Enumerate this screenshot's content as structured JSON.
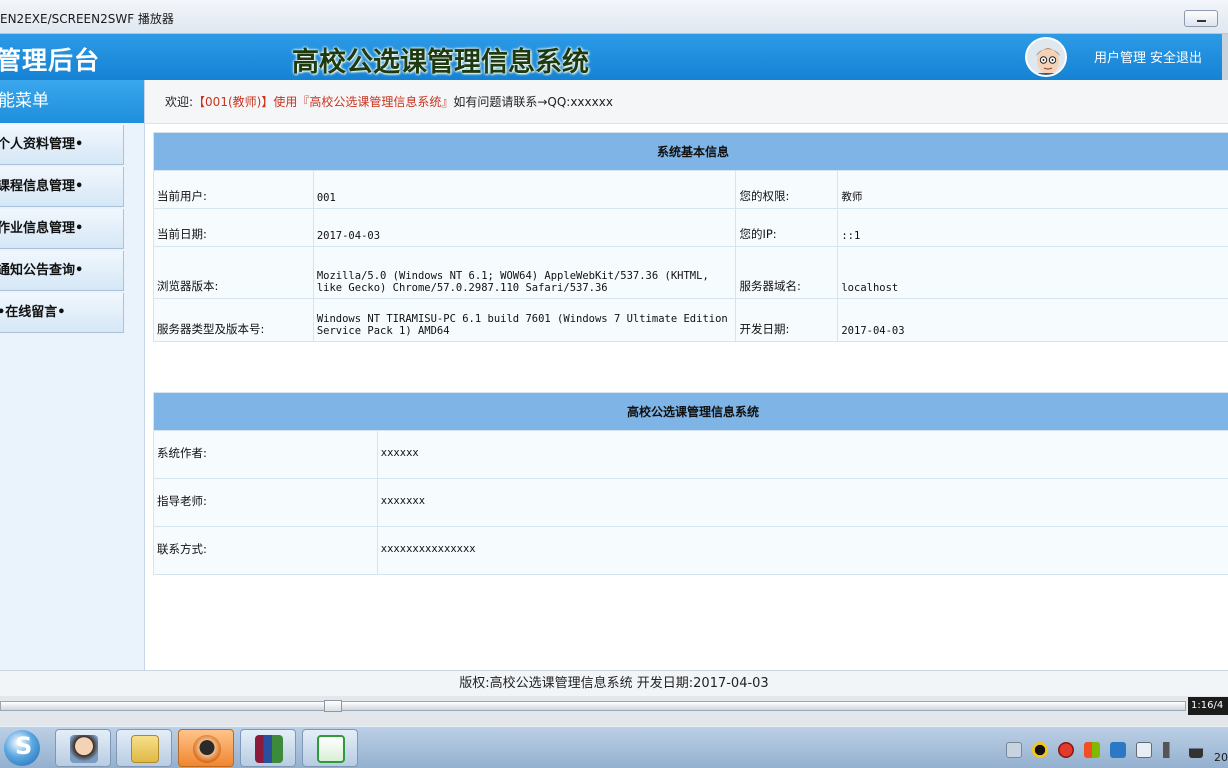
{
  "player": {
    "title": "EN2EXE/SCREEN2SWF 播放器",
    "timecode": "1:16/4"
  },
  "header": {
    "brand": "管理后台",
    "system_title": "高校公选课管理信息系统",
    "user_manage": "用户管理",
    "logout": "安全退出"
  },
  "sidebar": {
    "title": "能菜单",
    "items": [
      {
        "label": "个人资料管理•"
      },
      {
        "label": "课程信息管理•"
      },
      {
        "label": "作业信息管理•"
      },
      {
        "label": "通知公告查询•"
      },
      {
        "label": "•在线留言•"
      }
    ]
  },
  "welcome": {
    "prefix": "欢迎:",
    "user_highlight": "【001(教师)】使用『高校公选课管理信息系统』",
    "suffix": "如有问题请联系→QQ:xxxxxx"
  },
  "system_info": {
    "title": "系统基本信息",
    "rows": [
      {
        "label": "当前用户:",
        "value": "001",
        "label2": "您的权限:",
        "value2": "教师"
      },
      {
        "label": "当前日期:",
        "value": "2017-04-03",
        "label2": "您的IP:",
        "value2": "::1"
      },
      {
        "label": "浏览器版本:",
        "value": "Mozilla/5.0 (Windows NT 6.1; WOW64) AppleWebKit/537.36 (KHTML, like Gecko) Chrome/57.0.2987.110 Safari/537.36",
        "label2": "服务器域名:",
        "value2": "localhost"
      },
      {
        "label": "服务器类型及版本号:",
        "value": "Windows NT TIRAMISU-PC 6.1 build 7601 (Windows 7 Ultimate Edition Service Pack 1) AMD64",
        "label2": "开发日期:",
        "value2": "2017-04-03"
      }
    ]
  },
  "about": {
    "title": "高校公选课管理信息系统",
    "rows": [
      {
        "label": "系统作者:",
        "value": "xxxxxx"
      },
      {
        "label": "指导老师:",
        "value": "xxxxxxx"
      },
      {
        "label": "联系方式:",
        "value": "xxxxxxxxxxxxxxx"
      }
    ]
  },
  "footer": {
    "text": "版权:高校公选课管理信息系统 开发日期:2017-04-03"
  },
  "taskbar": {
    "clock": "20"
  },
  "colors": {
    "header_blue": "#1682d4",
    "table_head": "#7fb5e6",
    "highlight_red": "#c8341f"
  }
}
